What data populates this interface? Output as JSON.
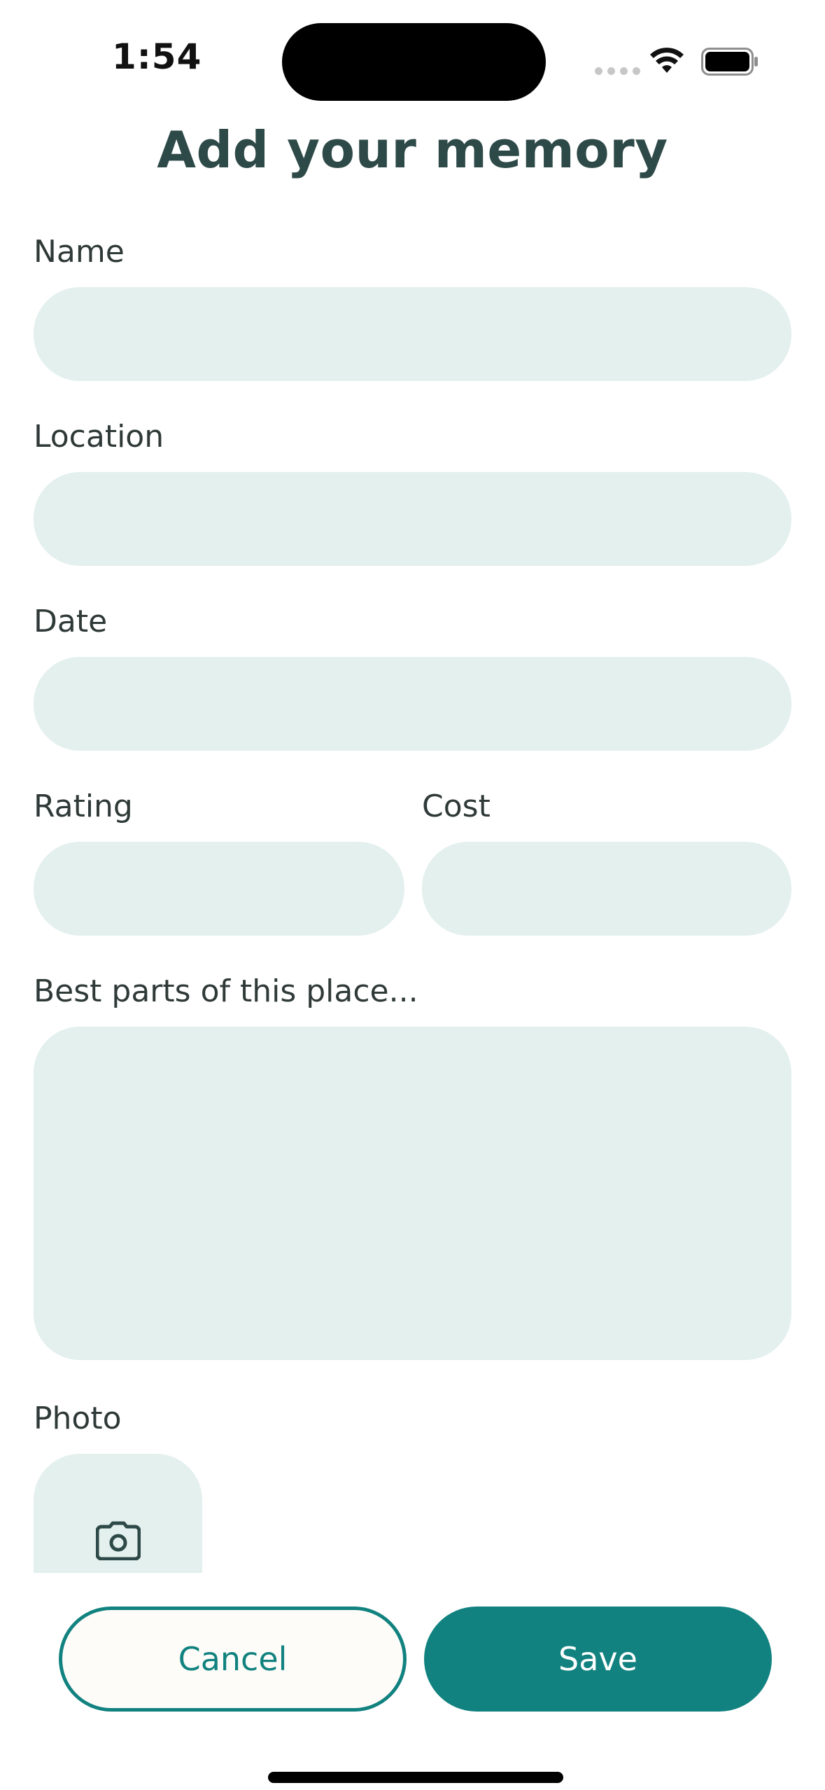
{
  "status_bar": {
    "time": "1:54"
  },
  "title": "Add your memory",
  "form": {
    "name_label": "Name",
    "location_label": "Location",
    "date_label": "Date",
    "rating_label": "Rating",
    "cost_label": "Cost",
    "best_parts_label": "Best parts of this place...",
    "photo_label": "Photo"
  },
  "buttons": {
    "cancel": "Cancel",
    "save": "Save"
  },
  "icons": {
    "photo_picker": "camera-icon",
    "wifi": "wifi-icon",
    "battery": "battery-icon"
  },
  "colors": {
    "accent": "#11827f",
    "title": "#2e4a48",
    "field_bg": "#e3f0ed"
  }
}
